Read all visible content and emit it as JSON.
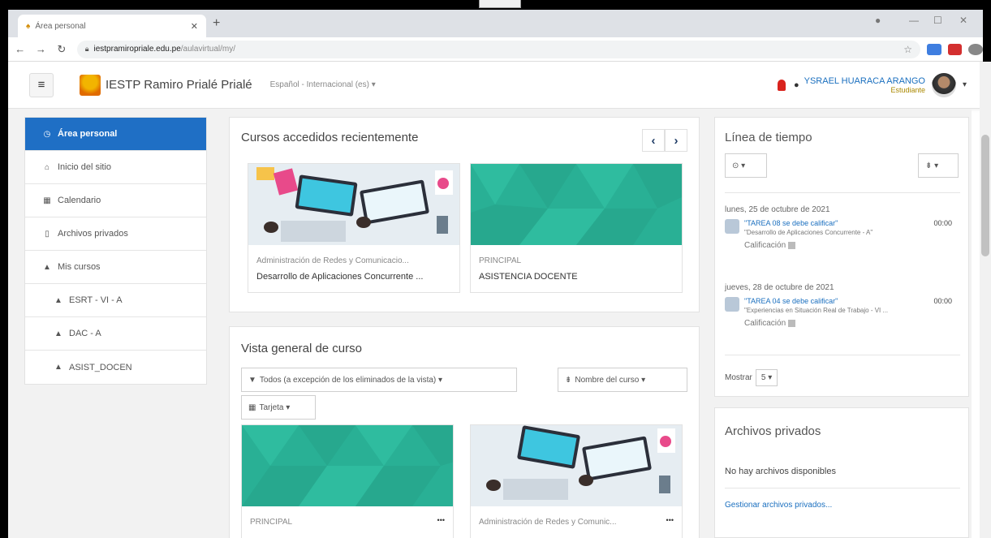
{
  "browser": {
    "tab_title": "Área personal",
    "url_host": "iestpramiropriale.edu.pe",
    "url_path": "/aulavirtual/my/"
  },
  "navbar": {
    "site_name": "IESTP Ramiro Prialé Prialé",
    "language": "Español - Internacional (es) ▾",
    "user_name": "YSRAEL HUARACA ARANGO",
    "user_role": "Estudiante"
  },
  "drawer": {
    "items": [
      {
        "label": "Área personal",
        "icon": "tachometer-icon"
      },
      {
        "label": "Inicio del sitio",
        "icon": "home-icon"
      },
      {
        "label": "Calendario",
        "icon": "calendar-icon"
      },
      {
        "label": "Archivos privados",
        "icon": "file-icon"
      },
      {
        "label": "Mis cursos",
        "icon": "graduation-cap-icon"
      },
      {
        "label": "ESRT - VI - A",
        "icon": "graduation-cap-icon"
      },
      {
        "label": "DAC - A",
        "icon": "graduation-cap-icon"
      },
      {
        "label": "ASIST_DOCEN",
        "icon": "graduation-cap-icon"
      }
    ]
  },
  "recent": {
    "title": "Cursos accedidos recientemente",
    "courses": [
      {
        "category": "Administración de Redes y Comunicacio...",
        "name": "Desarrollo de Aplicaciones Concurrente ..."
      },
      {
        "category": "PRINCIPAL",
        "name": "ASISTENCIA DOCENTE"
      }
    ]
  },
  "overview": {
    "title": "Vista general de curso",
    "filter": "Todos (a excepción de los eliminados de la vista) ▾",
    "sort": "Nombre del curso ▾",
    "view": "Tarjeta ▾",
    "courses": [
      {
        "category": "PRINCIPAL",
        "menu": "•••"
      },
      {
        "category": "Administración de Redes y Comunic...",
        "menu": "•••"
      }
    ]
  },
  "timeline": {
    "title": "Línea de tiempo",
    "filter_btn": "⊙ ▾",
    "sort_btn": "⇟ ▾",
    "events": [
      {
        "date": "lunes, 25 de octubre de 2021",
        "name": "\"TAREA 08 se debe calificar\"",
        "course": "\"Desarrollo de Aplicaciones Concurrente - A\"",
        "time": "00:00",
        "action": "Calificación"
      },
      {
        "date": "jueves, 28 de octubre de 2021",
        "name": "\"TAREA 04 se debe calificar\"",
        "course": "\"Experiencias en Situación Real de Trabajo - VI ...",
        "time": "00:00",
        "action": "Calificación"
      }
    ],
    "show_label": "Mostrar",
    "show_value": "5 ▾"
  },
  "private_files": {
    "title": "Archivos privados",
    "empty": "No hay archivos disponibles",
    "manage_link": "Gestionar archivos privados..."
  },
  "colors": {
    "accent": "#1f6fc5",
    "course_green": "#29b095"
  }
}
